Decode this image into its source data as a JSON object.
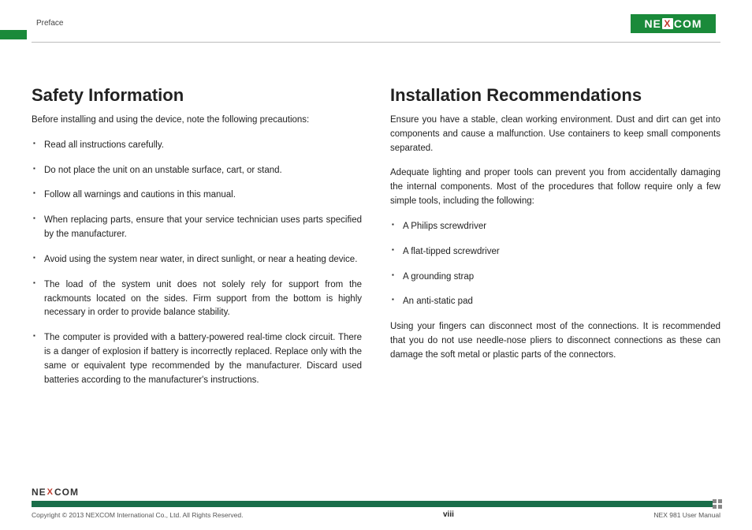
{
  "header": {
    "section": "Preface",
    "logo_left": "NE",
    "logo_x": "X",
    "logo_right": "COM"
  },
  "left": {
    "title": "Safety Information",
    "intro": "Before installing and using the device, note the following precautions:",
    "items": [
      "Read all instructions carefully.",
      "Do not place the unit on an unstable surface, cart, or stand.",
      "Follow all warnings and cautions in this manual.",
      "When replacing parts, ensure that your service technician uses parts specified by the manufacturer.",
      "Avoid using the system near water, in direct sunlight, or near a heating device.",
      "The load of the system unit does not solely rely for support from the rackmounts located on the sides. Firm support from the bottom is highly necessary in order to provide balance stability.",
      "The computer is provided with a battery-powered real-time clock circuit. There is a danger of explosion if battery is incorrectly replaced. Replace only with the same or equivalent type recommended by the manufacturer. Discard used batteries according to the manufacturer's instructions."
    ]
  },
  "right": {
    "title": "Installation Recommendations",
    "p1": "Ensure you have a stable, clean working environment. Dust and dirt can get into components and cause a malfunction. Use containers to keep small components separated.",
    "p2": "Adequate lighting and proper tools can prevent you from accidentally damaging the internal components. Most of the procedures that follow require only a few simple tools, including the following:",
    "tools": [
      "A Philips screwdriver",
      "A flat-tipped screwdriver",
      "A grounding strap",
      "An anti-static pad"
    ],
    "p3": "Using your fingers can disconnect most of the connections. It is recommended that you do not use needle-nose pliers to disconnect connections as these can damage the soft metal or plastic parts of the connectors."
  },
  "footer": {
    "copyright": "Copyright © 2013 NEXCOM International Co., Ltd. All Rights Reserved.",
    "page": "viii",
    "doc": "NEX 981 User Manual"
  }
}
